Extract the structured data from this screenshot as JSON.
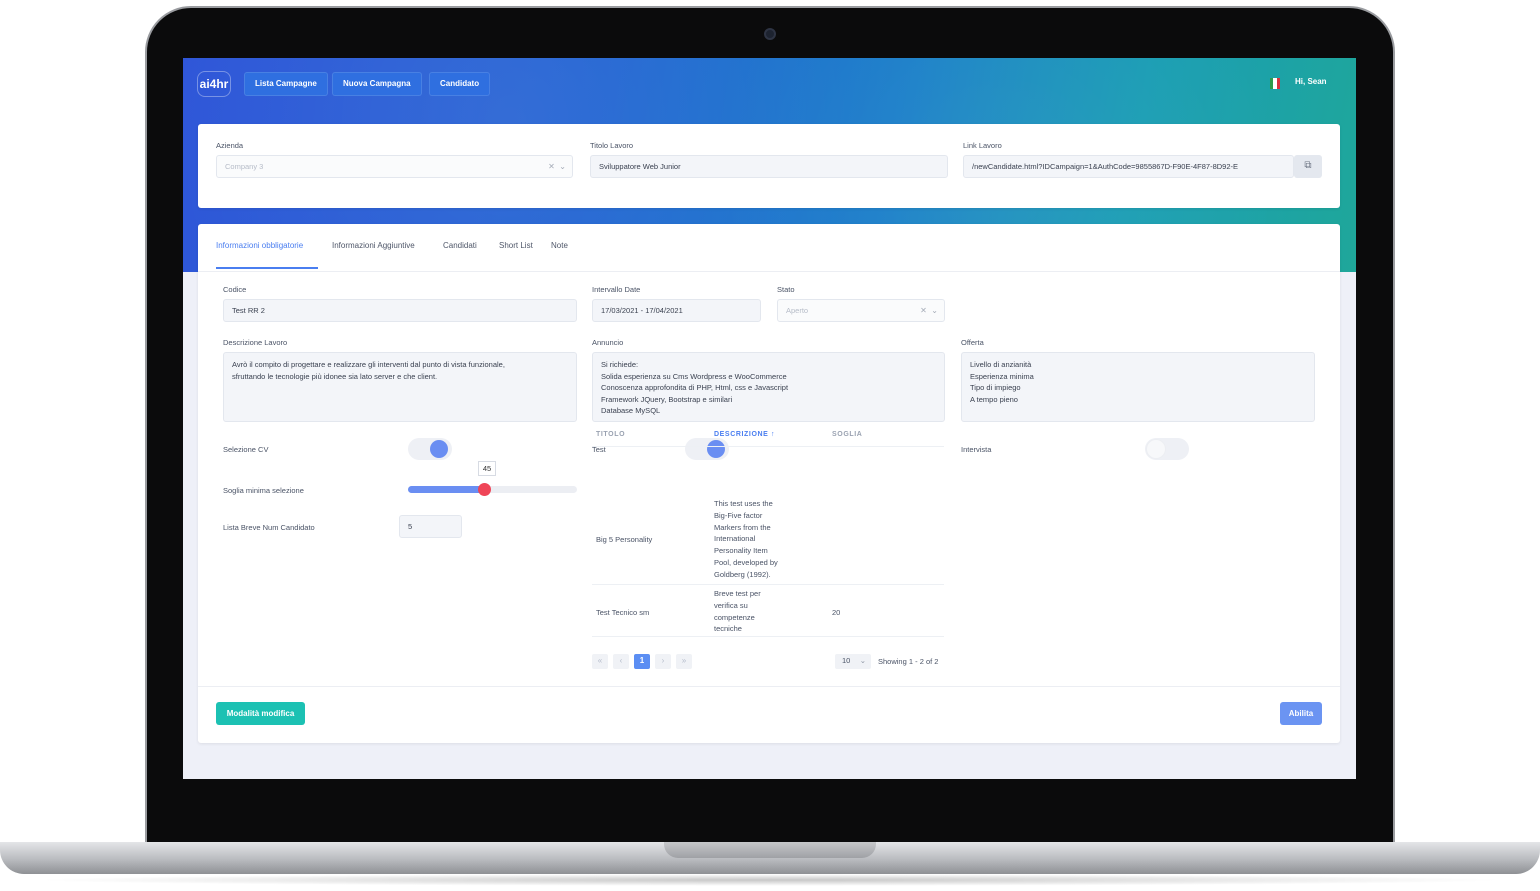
{
  "nav": {
    "logo": "ai4hr",
    "buttons": [
      "Lista Campagne",
      "Nuova Campagna",
      "Candidato"
    ],
    "greeting": "Hi, Sean"
  },
  "campaign": {
    "azienda": {
      "label": "Azienda",
      "value": "Company 3"
    },
    "titolo": {
      "label": "Titolo Lavoro",
      "value": "Sviluppatore Web Junior"
    },
    "link": {
      "label": "Link Lavoro",
      "value": "/newCandidate.html?IDCampaign=1&AuthCode=9855867D-F90E-4F87-8D92-E"
    }
  },
  "tabs": [
    {
      "label": "Informazioni obbligatorie",
      "active": true
    },
    {
      "label": "Informazioni Aggiuntive"
    },
    {
      "label": "Candidati"
    },
    {
      "label": "Short List"
    },
    {
      "label": "Note"
    }
  ],
  "form": {
    "codice": {
      "label": "Codice",
      "value": "Test RR 2"
    },
    "intervallo": {
      "label": "Intervallo Date",
      "value": "17/03/2021 - 17/04/2021"
    },
    "stato": {
      "label": "Stato",
      "value": "Aperto"
    },
    "descrizione": {
      "label": "Descrizione Lavoro",
      "lines": [
        "Avrò il compito di progettare e realizzare gli interventi dal punto di vista funzionale,",
        "sfruttando le tecnologie più idonee sia lato server e che client."
      ]
    },
    "annuncio": {
      "label": "Annuncio",
      "lines": [
        "Si richiede:",
        "Solida esperienza su Cms Wordpress e WooCommerce",
        "Conoscenza approfondita di PHP, Html, css e Javascript",
        "Framework JQuery, Bootstrap e similari",
        "Database MySQL"
      ]
    },
    "offerta": {
      "label": "Offerta",
      "lines": [
        "Livello di anzianità",
        "Esperienza minima",
        "Tipo di impiego",
        "A tempo pieno"
      ]
    },
    "selezione_cv": {
      "label": "Selezione CV",
      "on": true
    },
    "test": {
      "label": "Test",
      "on": true
    },
    "intervista": {
      "label": "Intervista",
      "on": false
    },
    "soglia": {
      "label": "Soglia minima selezione",
      "value": "45",
      "fraction": 0.45
    },
    "lista_breve": {
      "label": "Lista Breve Num Candidato",
      "value": "5"
    }
  },
  "tests_table": {
    "headers": [
      "TITOLO",
      "DESCRIZIONE",
      "SOGLIA"
    ],
    "sort_icon": "↑",
    "rows": [
      {
        "titolo": "Big 5 Personality",
        "descrizione": [
          "This test uses the",
          "Big-Five factor",
          "Markers from the",
          "International",
          "Personality Item",
          "Pool, developed by",
          "Goldberg (1992)."
        ],
        "soglia": ""
      },
      {
        "titolo": "Test Tecnico sm",
        "descrizione": [
          "Breve test per",
          "verifica su",
          "competenze",
          "tecniche"
        ],
        "soglia": "20"
      }
    ],
    "pagination": {
      "first": "«",
      "prev": "‹",
      "current": "1",
      "next": "›",
      "last": "»",
      "per_page": "10",
      "per_page_caret": "⌄",
      "showing": "Showing 1 - 2 of 2"
    }
  },
  "actions": {
    "modify": "Modalità modifica",
    "enable": "Abilita"
  },
  "colors": {
    "accent": "#4a7ef0",
    "modify_button": "#1cc1b3",
    "enable_button": "#6b94f2",
    "slider_thumb": "#ef4557"
  }
}
